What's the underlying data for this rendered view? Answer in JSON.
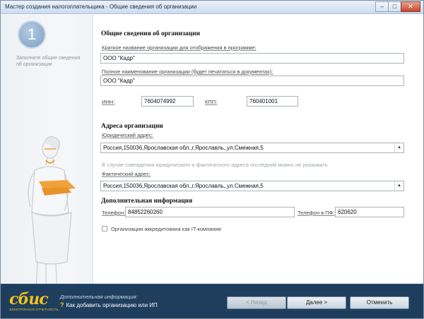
{
  "window": {
    "title": "Мастер создания налогоплательщика - Общие сведения об организации",
    "controls": {
      "minimize": "–",
      "maximize": "□",
      "close": "✕"
    }
  },
  "sidebar": {
    "step_number": "1",
    "step_hint": "Заполните общие сведения об организации"
  },
  "general": {
    "section_title": "Общие сведения об организации",
    "short_name_label": "Краткое название организации для отображения в программе:",
    "short_name_value": "ООО \"Кадр\"",
    "full_name_label": "Полное наименование организации (будет печататься в документах):",
    "full_name_value": "ООО \"Кадр\"",
    "inn_label": "ИНН:",
    "inn_value": "7604074992",
    "kpp_label": "КПП:",
    "kpp_value": "760401001"
  },
  "address": {
    "section_title": "Адреса организации",
    "legal_label": "Юридический адрес:",
    "legal_value": "Россия,150036,Ярославская обл.,г.Ярославль,,ул.Смежная,5",
    "hint": "В случае совпадения юридического и фактического адреса последний можно не указывать",
    "actual_label": "Фактический адрес:",
    "actual_value": "Россия,150036,Ярославская обл.,г.Ярославль,,ул.Смежная,5",
    "dropdown_glyph": "▲"
  },
  "extra": {
    "section_title": "Дополнительная информация",
    "phone_label": "Телефон:",
    "phone_value": "84852260260",
    "pf_phone_label": "Телефон в ПФ:",
    "pf_phone_value": "620620",
    "it_checkbox_label": "Организация аккредитована как IT-компания",
    "it_checked": false
  },
  "footer": {
    "logo_text": "сбис",
    "logo_sub": "ЭЛЕКТРОННАЯ ОТЧЕТНОСТЬ",
    "info_title": "Дополнительная информация:",
    "info_link": "Как добавить организацию или ИП",
    "info_link_icon": "?",
    "back_label": "< Назад",
    "next_label": "Далее >",
    "cancel_label": "Отменить"
  },
  "colors": {
    "footer_bg": "#1f3e5e",
    "logo": "#f3c21c",
    "accent_orange": "#f0a23a"
  }
}
